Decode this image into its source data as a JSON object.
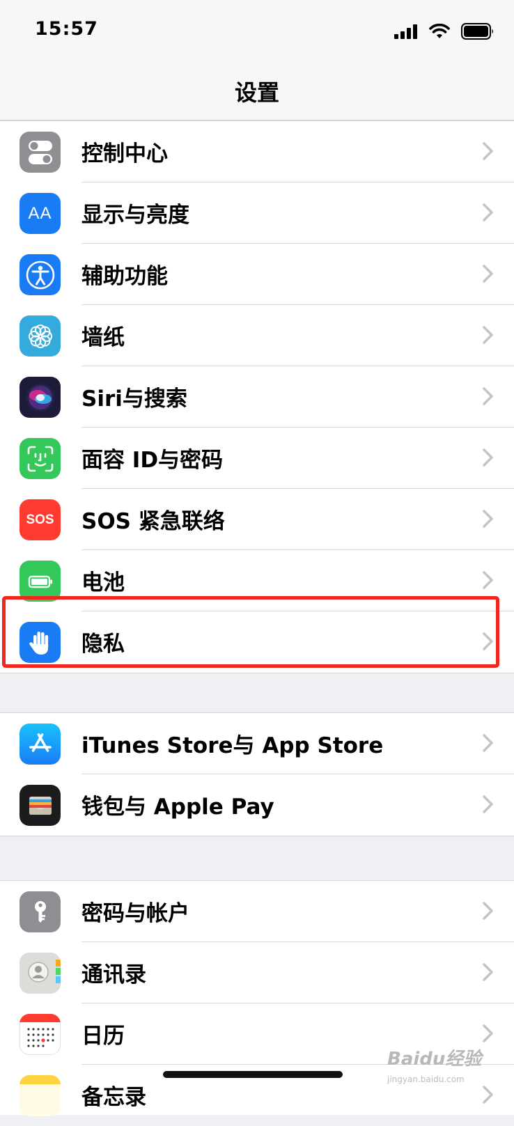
{
  "status_bar": {
    "time": "15:57"
  },
  "nav": {
    "title": "设置"
  },
  "groups": [
    {
      "items": [
        {
          "label": "控制中心",
          "icon": "control-center-icon",
          "color": "#8e8e93"
        },
        {
          "label": "显示与亮度",
          "icon": "display-brightness-icon",
          "color": "#1a7cf5"
        },
        {
          "label": "辅助功能",
          "icon": "accessibility-icon",
          "color": "#1a7cf5"
        },
        {
          "label": "墙纸",
          "icon": "wallpaper-icon",
          "color": "#35aadc"
        },
        {
          "label": "Siri与搜索",
          "icon": "siri-icon",
          "color": "#1c1c3a"
        },
        {
          "label": "面容 ID与密码",
          "icon": "face-id-icon",
          "color": "#34c759"
        },
        {
          "label": "SOS 紧急联络",
          "icon": "sos-icon",
          "color": "#ff3b30"
        },
        {
          "label": "电池",
          "icon": "battery-icon",
          "color": "#34c759"
        },
        {
          "label": "隐私",
          "icon": "privacy-hand-icon",
          "color": "#1a7cf5"
        }
      ]
    },
    {
      "items": [
        {
          "label": "iTunes Store与 App Store",
          "icon": "app-store-icon",
          "color": "#1a8cf5"
        },
        {
          "label": "钱包与 Apple Pay",
          "icon": "wallet-icon",
          "color": "#1c1c1e"
        }
      ]
    },
    {
      "items": [
        {
          "label": "密码与帐户",
          "icon": "passwords-key-icon",
          "color": "#8e8e93"
        },
        {
          "label": "通讯录",
          "icon": "contacts-icon",
          "color": "#d8d8d8"
        },
        {
          "label": "日历",
          "icon": "calendar-icon",
          "color": "#ffffff"
        },
        {
          "label": "备忘录",
          "icon": "notes-icon",
          "color": "#ffcc00"
        }
      ]
    }
  ],
  "icon_text": {
    "display": "AA",
    "sos": "SOS"
  },
  "watermark": {
    "logo": "Baidu经验",
    "url": "jingyan.baidu.com"
  },
  "colors": {
    "highlight": "#f0261c",
    "background": "#efeff4",
    "separator": "#d9d9dc",
    "chevron": "#c4c4c7"
  }
}
